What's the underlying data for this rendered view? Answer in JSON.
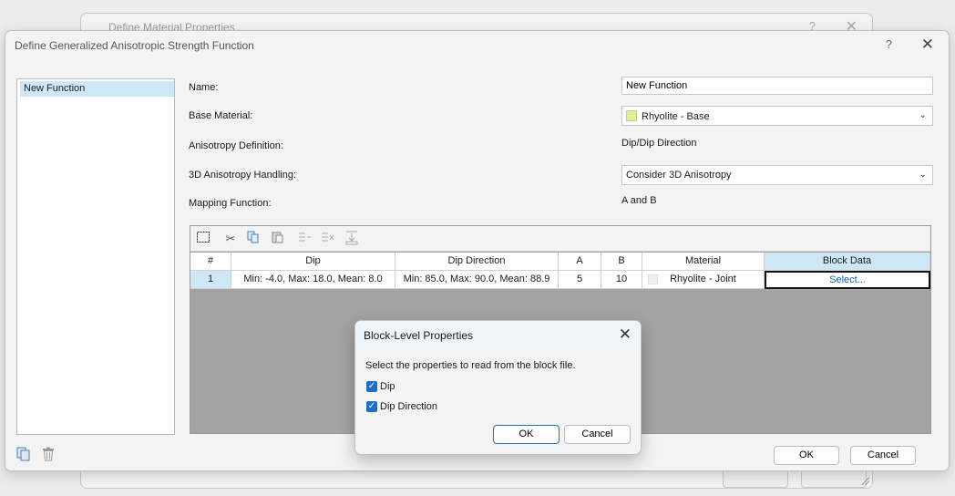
{
  "background_dialog": {
    "title": "Define Material Properties",
    "help_icon": "?",
    "close_icon": "✕"
  },
  "main_dialog": {
    "title": "Define Generalized Anisotropic Strength Function",
    "help_icon": "?",
    "close_icon": "✕",
    "function_list": [
      "New Function"
    ],
    "fields": {
      "name_label": "Name:",
      "name_value": "New Function",
      "base_material_label": "Base Material:",
      "base_material_value": "Rhyolite - Base",
      "anisotropy_definition_label": "Anisotropy Definition:",
      "anisotropy_definition_value": "Dip/Dip Direction",
      "handling_label": "3D Anisotropy Handling:",
      "handling_value": "Consider 3D Anisotropy",
      "mapping_label": "Mapping Function:",
      "mapping_value": "A and B"
    },
    "table": {
      "headers": [
        "#",
        "Dip",
        "Dip Direction",
        "A",
        "B",
        "Material",
        "Block Data"
      ],
      "rows": [
        {
          "num": "1",
          "dip": "Min: -4.0, Max: 18.0, Mean: 8.0",
          "dip_direction": "Min: 85.0, Max: 90.0, Mean: 88.9",
          "a": "5",
          "b": "10",
          "material": "Rhyolite - Joint",
          "block_data": "Select..."
        }
      ]
    },
    "buttons": {
      "ok": "OK",
      "cancel": "Cancel"
    }
  },
  "modal": {
    "title": "Block-Level Properties",
    "message": "Select the properties to read from the block file.",
    "checkboxes": [
      {
        "label": "Dip",
        "checked": true
      },
      {
        "label": "Dip Direction",
        "checked": true
      }
    ],
    "ok": "OK",
    "cancel": "Cancel"
  },
  "colors": {
    "selection": "#cde7f7",
    "base_material_swatch": "#e1ec9c",
    "accent": "#1e6fc4"
  }
}
